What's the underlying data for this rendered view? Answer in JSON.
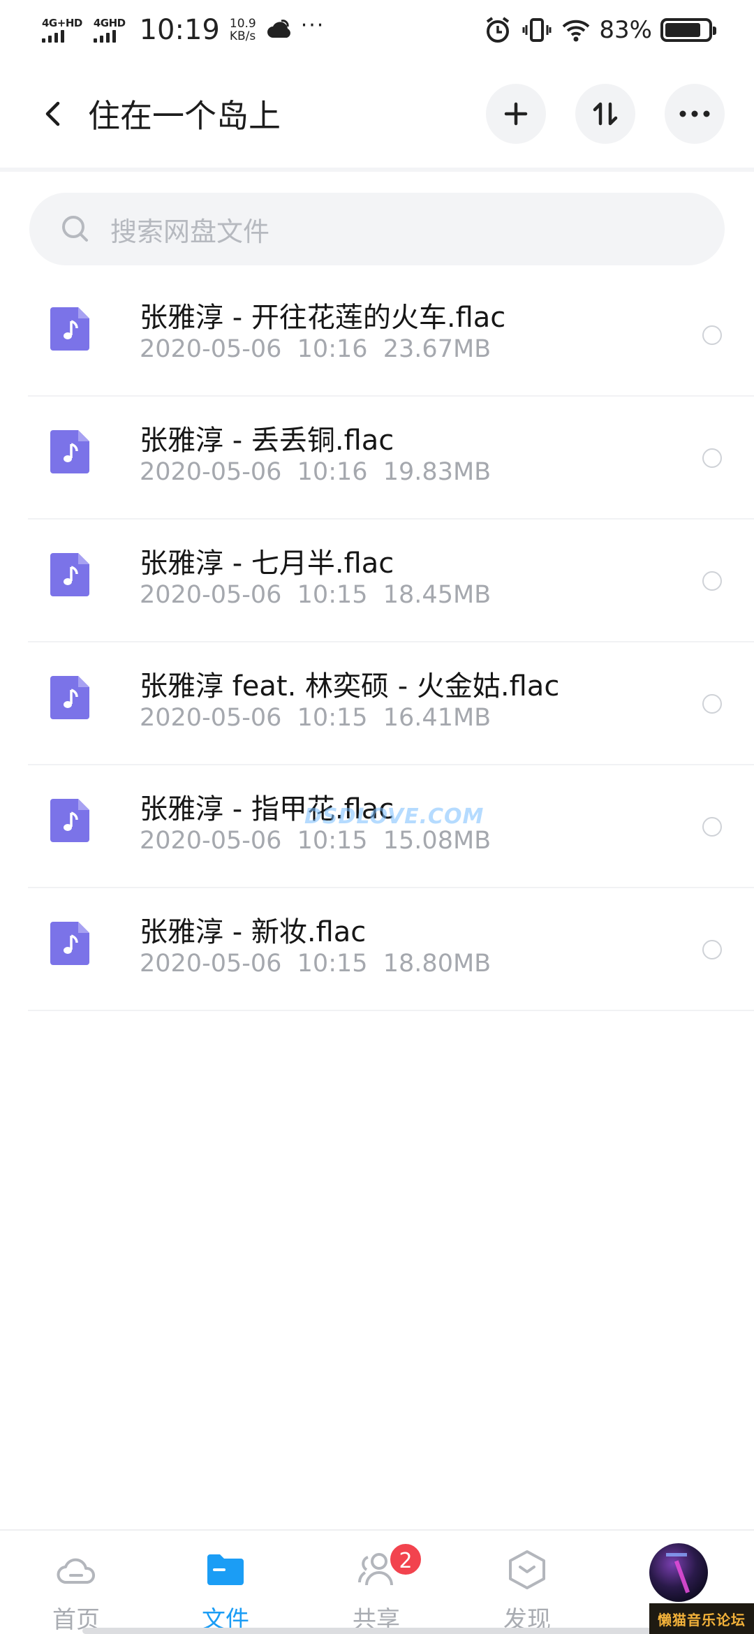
{
  "status_bar": {
    "network1": "4G+HD",
    "network2": "4GHD",
    "time": "10:19",
    "speed_value": "10.9",
    "speed_unit": "KB/s",
    "more": "···",
    "battery_pct": "83%",
    "battery_level": 0.83
  },
  "header": {
    "title": "住在一个岛上"
  },
  "search": {
    "placeholder": "搜索网盘文件"
  },
  "files": [
    {
      "name": "张雅淳 - 开往花莲的火车.flac",
      "meta": "2020-05-06  10:16  23.67MB"
    },
    {
      "name": "张雅淳 - 丢丢铜.flac",
      "meta": "2020-05-06  10:16  19.83MB"
    },
    {
      "name": "张雅淳 - 七月半.flac",
      "meta": "2020-05-06  10:15  18.45MB"
    },
    {
      "name": "张雅淳 feat. 林奕硕 - 火金姑.flac",
      "meta": "2020-05-06  10:15  16.41MB"
    },
    {
      "name": "张雅淳 - 指甲花.flac",
      "meta": "2020-05-06  10:15  15.08MB"
    },
    {
      "name": "张雅淳 - 新妆.flac",
      "meta": "2020-05-06  10:15  18.80MB"
    }
  ],
  "watermark": "DSDLOVE.COM",
  "nav": {
    "home": "首页",
    "files": "文件",
    "share": "共享",
    "share_badge": "2",
    "discover": "发现"
  },
  "forum_badge": "懒猫音乐论坛",
  "colors": {
    "accent": "#1b9df5",
    "file_icon": "#7b73e8",
    "badge": "#f2434e"
  }
}
